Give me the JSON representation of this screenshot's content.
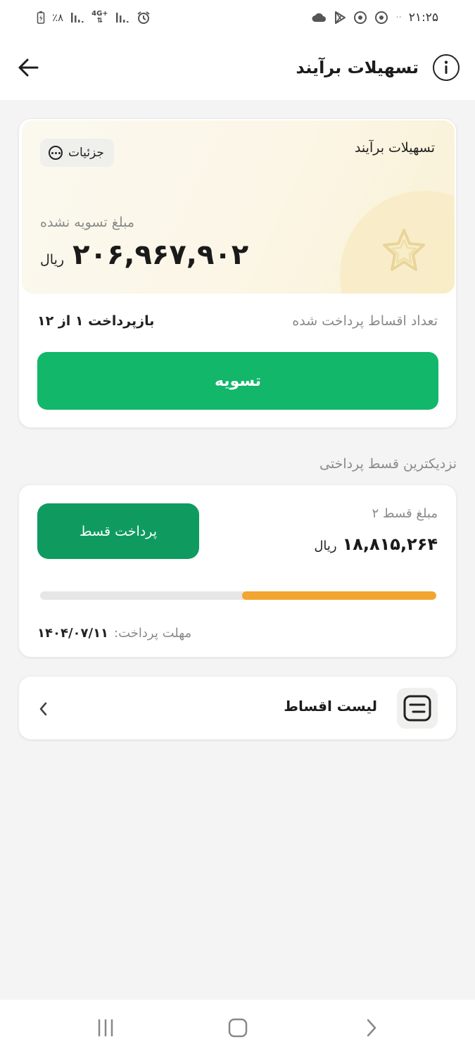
{
  "status_bar": {
    "time": "۲۱:۲۵",
    "battery": "٪۸",
    "network": "4G+",
    "dots": "··"
  },
  "header": {
    "title": "تسهیلات برآیند"
  },
  "loan_card": {
    "name": "تسهیلات برآیند",
    "details_label": "جزئیات",
    "unsettled_label": "مبلغ تسویه نشده",
    "unsettled_amount": "۲۰۶,۹۶۷,۹۰۲",
    "currency": "ریال",
    "paid_count_label": "تعداد اقساط پرداخت شده",
    "paid_count_value": "بازپرداخت ۱ از ۱۲",
    "settle_button": "تسویه"
  },
  "next_installment": {
    "section_title": "نزدیکترین قسط پرداختی",
    "pay_button": "پرداخت قسط",
    "installment_label": "مبلغ قسط ۲",
    "amount": "۱۸,۸۱۵,۲۶۴",
    "currency": "ریال",
    "progress_fraction": 0.49,
    "deadline_label": "مهلت پرداخت:",
    "deadline_date": "۱۴۰۴/۰۷/۱۱"
  },
  "installments_list": {
    "title": "لیست اقساط"
  },
  "colors": {
    "primary_green": "#12b76a",
    "pay_green": "#0f9b5f",
    "progress_orange": "#f2a52f"
  }
}
